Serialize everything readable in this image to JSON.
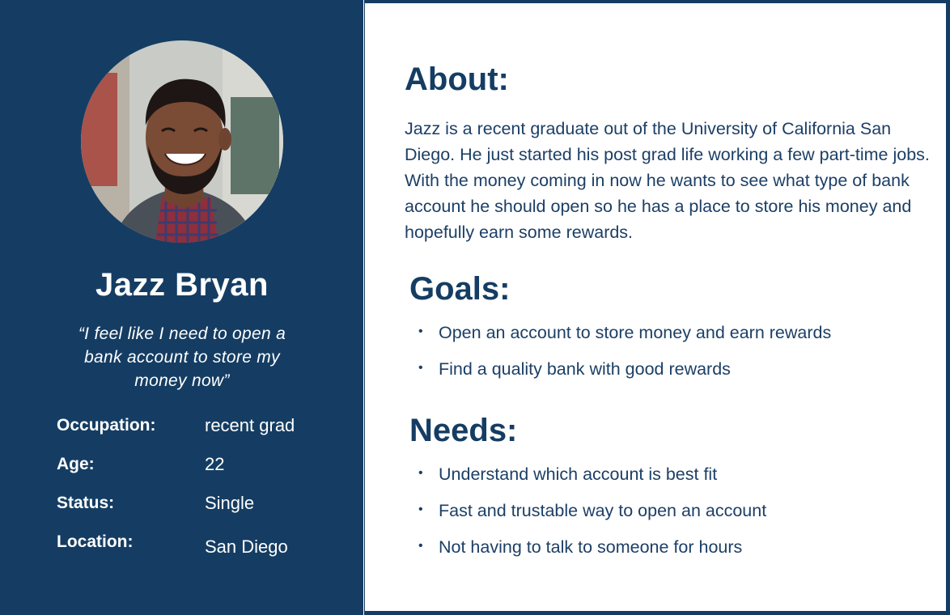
{
  "persona": {
    "name": "Jazz Bryan",
    "quote": "“I feel like I need to open a bank account to store my money now”",
    "facts": [
      {
        "label": "Occupation:",
        "value": "recent grad"
      },
      {
        "label": "Age:",
        "value": "22"
      },
      {
        "label": "Status:",
        "value": "Single"
      },
      {
        "label": "Location:",
        "value": "San Diego"
      }
    ]
  },
  "about": {
    "heading": "About:",
    "text": "Jazz is a recent graduate out of the University of California San Diego. He just started his post grad life working a few part-time jobs. With the money coming in now he wants to see what type of bank account he should open so he has a place to store his money and hopefully earn some rewards."
  },
  "goals": {
    "heading": "Goals:",
    "items": [
      "Open an account to store money and earn rewards",
      "Find a quality bank with good rewards"
    ]
  },
  "needs": {
    "heading": "Needs:",
    "items": [
      "Understand which account is best fit",
      "Fast and trustable way to open an account",
      "Not having to talk to someone for hours"
    ]
  },
  "bullet_glyph": "•",
  "colors": {
    "navy": "#153d63",
    "text_navy": "#1c3f66",
    "white": "#ffffff"
  }
}
